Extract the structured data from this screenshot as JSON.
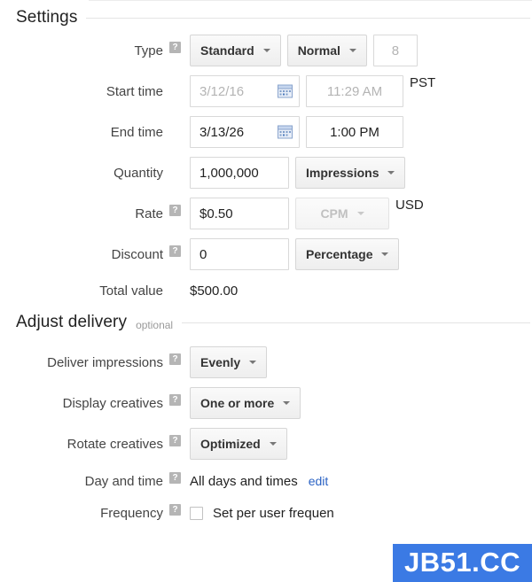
{
  "sections": {
    "settings": {
      "title": "Settings",
      "optional": ""
    },
    "adjust_delivery": {
      "title": "Adjust delivery",
      "optional": "optional"
    }
  },
  "help_glyph": "?",
  "rows": {
    "type": {
      "label": "Type",
      "standard": "Standard",
      "priority": "Normal",
      "priority_value": "8"
    },
    "start_time": {
      "label": "Start time",
      "date": "3/12/16",
      "time": "11:29 AM",
      "timezone": "PST"
    },
    "end_time": {
      "label": "End time",
      "date": "3/13/26",
      "time": "1:00 PM"
    },
    "quantity": {
      "label": "Quantity",
      "value": "1,000,000",
      "unit": "Impressions"
    },
    "rate": {
      "label": "Rate",
      "value": "$0.50",
      "unit": "CPM",
      "currency": "USD"
    },
    "discount": {
      "label": "Discount",
      "value": "0",
      "unit": "Percentage"
    },
    "total_value": {
      "label": "Total value",
      "value": "$500.00"
    },
    "deliver_impressions": {
      "label": "Deliver impressions",
      "value": "Evenly"
    },
    "display_creatives": {
      "label": "Display creatives",
      "value": "One or more"
    },
    "rotate_creatives": {
      "label": "Rotate creatives",
      "value": "Optimized"
    },
    "day_and_time": {
      "label": "Day and time",
      "value": "All days and times",
      "edit_link": "edit"
    },
    "frequency": {
      "label": "Frequency",
      "checkbox_label": "Set per user frequen"
    }
  },
  "watermark": {
    "text": "JB51.CC"
  },
  "colors": {
    "link": "#2b63c4",
    "watermark_bg": "#3b7ae4",
    "help_icon_bg": "#b5b5b5",
    "button_bg": "#f3f3f3",
    "disabled_text": "#b4b4b4"
  }
}
